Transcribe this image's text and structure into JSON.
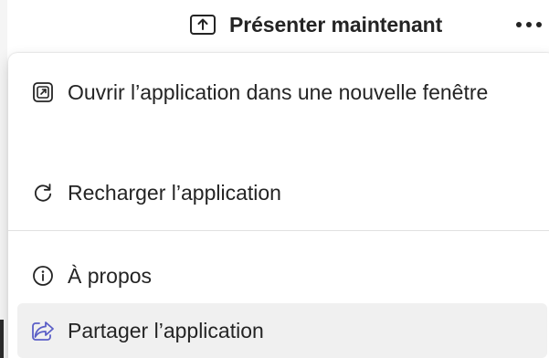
{
  "toolbar": {
    "present_label": "Présenter maintenant",
    "present_icon": "share-screen-icon",
    "more_icon": "more-horizontal-icon"
  },
  "menu": {
    "items": [
      {
        "label": "Ouvrir l’application dans une nouvelle fenêtre",
        "icon": "open-in-new-window-icon"
      },
      {
        "label": "Recharger l’application",
        "icon": "reload-icon"
      },
      {
        "label": "À propos",
        "icon": "info-icon"
      },
      {
        "label": "Partager l’application",
        "icon": "share-icon",
        "highlighted": true
      }
    ]
  },
  "colors": {
    "text": "#242424",
    "accent": "#5b5fc7",
    "hover_bg": "#f0f0f0",
    "divider": "#e1e1e1"
  }
}
